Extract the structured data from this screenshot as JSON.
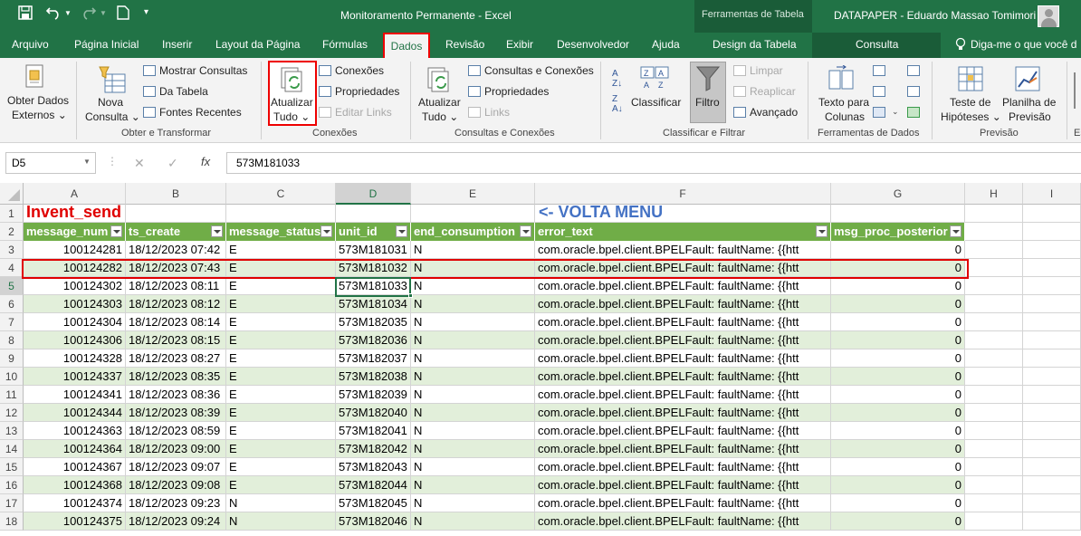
{
  "window": {
    "title": "Monitoramento Permanente  -  Excel",
    "context_tab_group": "Ferramentas de Tabela",
    "user": "DATAPAPER - Eduardo Massao Tomimori"
  },
  "tabs": [
    "Arquivo",
    "Página Inicial",
    "Inserir",
    "Layout da Página",
    "Fórmulas",
    "Dados",
    "Revisão",
    "Exibir",
    "Desenvolvedor",
    "Ajuda",
    "Design da Tabela",
    "Consulta"
  ],
  "tell_me": "Diga-me o que você d",
  "ribbon": {
    "obter_dados": [
      "Obter Dados",
      "Externos ⌄"
    ],
    "nova_consulta": [
      "Nova",
      "Consulta ⌄"
    ],
    "mostrar_consultas": "Mostrar Consultas",
    "da_tabela": "Da Tabela",
    "fontes_recentes": "Fontes Recentes",
    "group_obter": "Obter e Transformar",
    "atualizar_tudo": [
      "Atualizar",
      "Tudo ⌄"
    ],
    "conexoes": "Conexões",
    "propriedades": "Propriedades",
    "editar_links": "Editar Links",
    "group_conexoes": "Conexões",
    "atualizar_tudo2": [
      "Atualizar",
      "Tudo ⌄"
    ],
    "consultas_conexoes": "Consultas e Conexões",
    "propriedades2": "Propriedades",
    "links": "Links",
    "group_consultas": "Consultas e Conexões",
    "classificar": "Classificar",
    "filtro": "Filtro",
    "limpar": "Limpar",
    "reaplicar": "Reaplicar",
    "avancado": "Avançado",
    "group_classificar": "Classificar e Filtrar",
    "texto_colunas": [
      "Texto para",
      "Colunas"
    ],
    "group_ferramentas": "Ferramentas de Dados",
    "teste_hipoteses": [
      "Teste de",
      "Hipóteses ⌄"
    ],
    "planilha_previsao": [
      "Planilha de",
      "Previsão"
    ],
    "group_previsao": "Previsão",
    "group_cut": "Es"
  },
  "formula_bar": {
    "name_box": "D5",
    "cancel": "✕",
    "enter": "✓",
    "fx": "fx",
    "value": "573M181033"
  },
  "columns": [
    "A",
    "B",
    "C",
    "D",
    "E",
    "F",
    "G",
    "H",
    "I"
  ],
  "sheet": {
    "title": "Invent_send",
    "menu_link": "<- VOLTA MENU",
    "headers": [
      "message_num",
      "ts_create",
      "message_status",
      "unit_id",
      "end_consumption",
      "error_text",
      "msg_proc_posterior"
    ],
    "rows": [
      [
        "100124281",
        "18/12/2023 07:42",
        "E",
        "573M181031",
        "N",
        "com.oracle.bpel.client.BPELFault: faultName: {{htt",
        "0"
      ],
      [
        "100124282",
        "18/12/2023 07:43",
        "E",
        "573M181032",
        "N",
        "com.oracle.bpel.client.BPELFault: faultName: {{htt",
        "0"
      ],
      [
        "100124302",
        "18/12/2023 08:11",
        "E",
        "573M181033",
        "N",
        "com.oracle.bpel.client.BPELFault: faultName: {{htt",
        "0"
      ],
      [
        "100124303",
        "18/12/2023 08:12",
        "E",
        "573M181034",
        "N",
        "com.oracle.bpel.client.BPELFault: faultName: {{htt",
        "0"
      ],
      [
        "100124304",
        "18/12/2023 08:14",
        "E",
        "573M182035",
        "N",
        "com.oracle.bpel.client.BPELFault: faultName: {{htt",
        "0"
      ],
      [
        "100124306",
        "18/12/2023 08:15",
        "E",
        "573M182036",
        "N",
        "com.oracle.bpel.client.BPELFault: faultName: {{htt",
        "0"
      ],
      [
        "100124328",
        "18/12/2023 08:27",
        "E",
        "573M182037",
        "N",
        "com.oracle.bpel.client.BPELFault: faultName: {{htt",
        "0"
      ],
      [
        "100124337",
        "18/12/2023 08:35",
        "E",
        "573M182038",
        "N",
        "com.oracle.bpel.client.BPELFault: faultName: {{htt",
        "0"
      ],
      [
        "100124341",
        "18/12/2023 08:36",
        "E",
        "573M182039",
        "N",
        "com.oracle.bpel.client.BPELFault: faultName: {{htt",
        "0"
      ],
      [
        "100124344",
        "18/12/2023 08:39",
        "E",
        "573M182040",
        "N",
        "com.oracle.bpel.client.BPELFault: faultName: {{htt",
        "0"
      ],
      [
        "100124363",
        "18/12/2023 08:59",
        "E",
        "573M182041",
        "N",
        "com.oracle.bpel.client.BPELFault: faultName: {{htt",
        "0"
      ],
      [
        "100124364",
        "18/12/2023 09:00",
        "E",
        "573M182042",
        "N",
        "com.oracle.bpel.client.BPELFault: faultName: {{htt",
        "0"
      ],
      [
        "100124367",
        "18/12/2023 09:07",
        "E",
        "573M182043",
        "N",
        "com.oracle.bpel.client.BPELFault: faultName: {{htt",
        "0"
      ],
      [
        "100124368",
        "18/12/2023 09:08",
        "E",
        "573M182044",
        "N",
        "com.oracle.bpel.client.BPELFault: faultName: {{htt",
        "0"
      ],
      [
        "100124374",
        "18/12/2023 09:23",
        "N",
        "573M182045",
        "N",
        "com.oracle.bpel.client.BPELFault: faultName: {{htt",
        "0"
      ],
      [
        "100124375",
        "18/12/2023 09:24",
        "N",
        "573M182046",
        "N",
        "com.oracle.bpel.client.BPELFault: faultName: {{htt",
        "0"
      ]
    ]
  },
  "colors": {
    "excel_green": "#217346",
    "header_green": "#70ad47",
    "band_light": "#e2efda",
    "title_red": "#e00000",
    "link_blue": "#4472c4",
    "highlight_red": "#e00000"
  }
}
